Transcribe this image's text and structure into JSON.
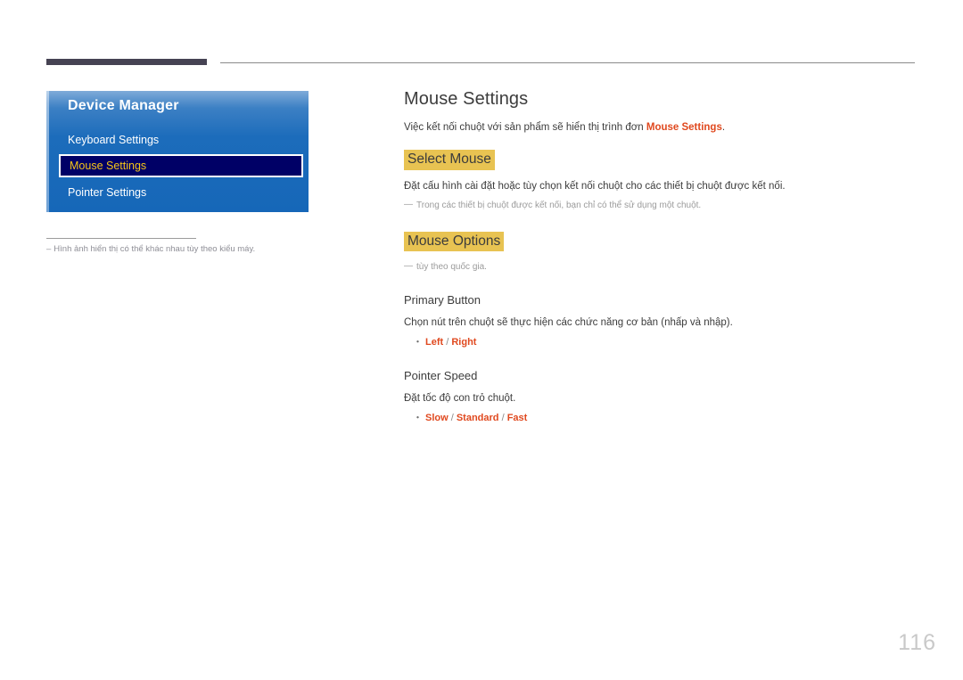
{
  "page": {
    "number": "116"
  },
  "osd": {
    "title": "Device Manager",
    "items": [
      {
        "label": "Keyboard Settings",
        "selected": false
      },
      {
        "label": "Mouse Settings",
        "selected": true
      },
      {
        "label": "Pointer Settings",
        "selected": false
      }
    ],
    "caption_dash": "‒",
    "caption": "Hình ảnh hiển thị có thể khác nhau tùy theo kiểu máy."
  },
  "content": {
    "title": "Mouse Settings",
    "intro": {
      "before": "Việc kết nối chuột với sản phẩm sẽ hiển thị trình đơn ",
      "accent": "Mouse Settings",
      "after": "."
    },
    "sections": [
      {
        "heading": "Select Mouse",
        "body": "Đặt cấu hình cài đặt hoặc tùy chọn kết nối chuột cho các thiết bị chuột được kết nối.",
        "note_dash": "―",
        "note": "Trong các thiết bị chuột được kết nối, bạn chỉ có thể sử dụng một chuột."
      },
      {
        "heading": "Mouse Options",
        "note_dash": "―",
        "note": "tùy theo quốc gia."
      }
    ],
    "subsections": [
      {
        "heading": "Primary Button",
        "body": "Chọn nút trên chuột sẽ thực hiện các chức năng cơ bản (nhấp và nhập).",
        "bullet": "・",
        "options": [
          "Left",
          "Right"
        ],
        "separator": " / "
      },
      {
        "heading": "Pointer Speed",
        "body": "Đặt tốc độ con trỏ chuột.",
        "bullet": "・",
        "options": [
          "Slow",
          "Standard",
          "Fast"
        ],
        "separator": " / "
      }
    ]
  },
  "colors": {
    "accent_orange": "#e0491f",
    "highlight_yellow": "#e8c352",
    "osd_blue": "#1667b8",
    "osd_selected_bg": "#000066",
    "osd_selected_text": "#f5c518",
    "rule_dark": "#464353",
    "page_number": "#c9c9c9"
  }
}
